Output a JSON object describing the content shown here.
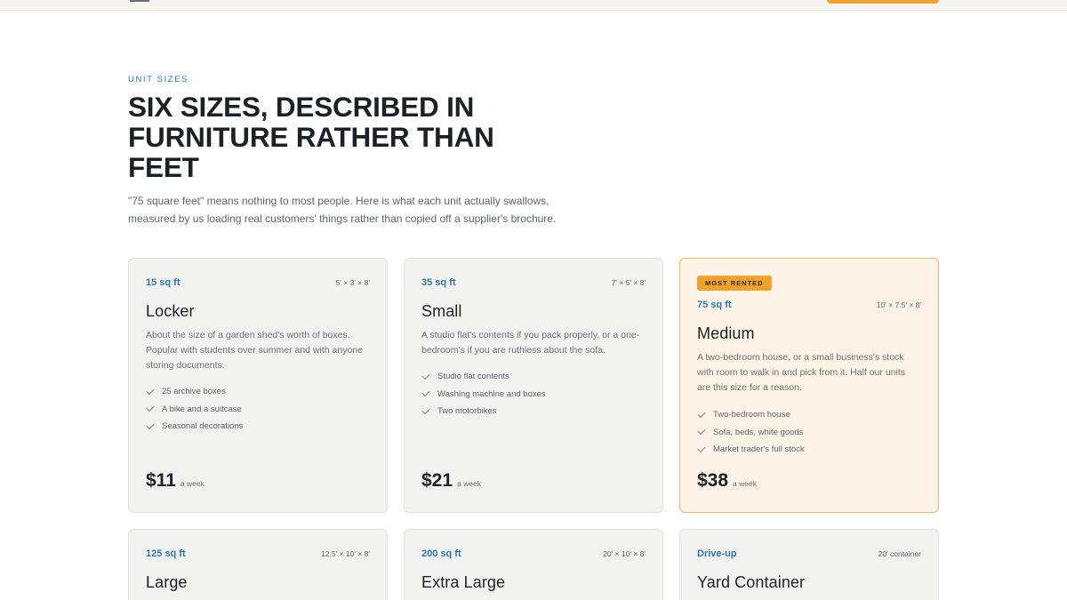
{
  "section": {
    "eyebrow": "UNIT SIZES",
    "title": "SIX SIZES, DESCRIBED IN FURNITURE RATHER THAN FEET",
    "intro": "\"75 square feet\" means nothing to most people. Here is what each unit actually swallows, measured by us loading real customers' things rather than copied off a supplier's brochure."
  },
  "units": [
    {
      "size": "15 sq ft",
      "dims": "5' × 3' × 8'",
      "name": "Locker",
      "desc": "About the size of a garden shed's worth of boxes. Popular with students over summer and with anyone storing documents.",
      "features": [
        "25 archive boxes",
        "A bike and a suitcase",
        "Seasonal decorations"
      ],
      "price": "$11",
      "per": "a week"
    },
    {
      "size": "35 sq ft",
      "dims": "7' × 5' × 8'",
      "name": "Small",
      "desc": "A studio flat's contents if you pack properly, or a one-bedroom's if you are ruthless about the sofa.",
      "features": [
        "Studio flat contents",
        "Washing machine and boxes",
        "Two motorbikes"
      ],
      "price": "$21",
      "per": "a week"
    },
    {
      "badge": "MOST RENTED",
      "size": "75 sq ft",
      "dims": "10' × 7.5' × 8'",
      "name": "Medium",
      "desc": "A two-bedroom house, or a small business's stock with room to walk in and pick from it. Half our units are this size for a reason.",
      "features": [
        "Two-bedroom house",
        "Sofa, beds, white goods",
        "Market trader's full stock"
      ],
      "price": "$38",
      "per": "a week"
    },
    {
      "size": "125 sq ft",
      "dims": "12.5' × 10' × 8'",
      "name": "Large"
    },
    {
      "size": "200 sq ft",
      "dims": "20' × 10' × 8'",
      "name": "Extra Large"
    },
    {
      "size": "Drive-up",
      "dims": "20' container",
      "name": "Yard Container"
    }
  ],
  "colors": {
    "accent": "#2f78a8",
    "highlight": "#efa22e",
    "featured_bg": "#fdf3e6"
  }
}
